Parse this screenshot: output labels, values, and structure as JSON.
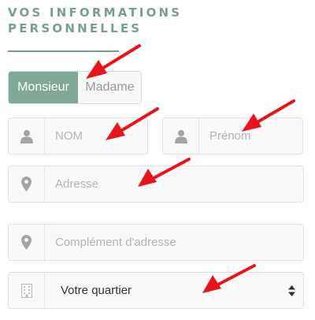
{
  "section": {
    "title_line1": "VOS INFORMATIONS",
    "title_line2": "PERSONNELLES"
  },
  "gender_toggle": {
    "options": [
      {
        "label": "Monsieur",
        "selected": true
      },
      {
        "label": "Madame",
        "selected": false
      }
    ]
  },
  "form": {
    "last_name": {
      "placeholder": "NOM",
      "value": "",
      "icon": "user-icon"
    },
    "first_name": {
      "placeholder": "Prénom",
      "value": "",
      "icon": "user-icon"
    },
    "address": {
      "placeholder": "Adresse",
      "value": "",
      "icon": "location-pin-icon"
    },
    "address_complement": {
      "placeholder": "Complément d'adresse",
      "value": "",
      "icon": "location-pin-icon"
    },
    "district": {
      "selected_label": "Votre quartier",
      "icon": "building-icon",
      "arrow_icon": "sort-arrows-icon"
    }
  },
  "colors": {
    "accent": "#7fa996",
    "title": "#7a9e8c",
    "annotation_arrow": "#e8141c",
    "field_background": "#f9f9f9",
    "placeholder": "#b4b4b4"
  },
  "annotations": {
    "arrow_count": 6,
    "arrow_color": "red"
  }
}
